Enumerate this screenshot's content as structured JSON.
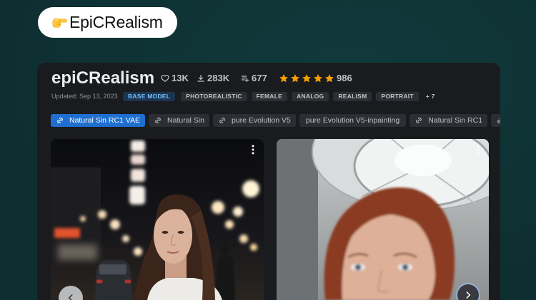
{
  "colors": {
    "background": "#0e2f31",
    "card": "#1a1b1e",
    "accent": "#1f6fd1",
    "star": "#f59f00",
    "base_model_bg": "#1b3450",
    "base_model_text": "#74c0fc",
    "tag_bg": "#2c2e33",
    "text_primary": "#e9ecef",
    "text_secondary": "#c1c2c5",
    "text_muted": "#909296"
  },
  "header": {
    "icon": "pointing-right-hand-icon",
    "title": "EpiCRealism"
  },
  "model": {
    "title": "epiCRealism",
    "stats": [
      {
        "icon": "heart-icon",
        "value": "13K"
      },
      {
        "icon": "download-icon",
        "value": "283K"
      },
      {
        "icon": "playlist-add-icon",
        "value": "677"
      }
    ],
    "rating": {
      "stars": 5,
      "max": 5,
      "count": "986"
    },
    "updated": "Updated: Sep 13, 2023",
    "base_model_label": "BASE MODEL",
    "tags": [
      "PHOTOREALISTIC",
      "FEMALE",
      "ANALOG",
      "REALISM",
      "PORTRAIT"
    ],
    "more_tags": "+ 7"
  },
  "versions": {
    "selected": 0,
    "items": [
      {
        "label": "Natural Sin RC1 VAE",
        "icon": "link-icon"
      },
      {
        "label": "Natural Sin",
        "icon": "link-icon"
      },
      {
        "label": "pure Evolution V5",
        "icon": "link-icon"
      },
      {
        "label": "pure Evolution V5-inpainting"
      },
      {
        "label": "Natural Sin RC1",
        "icon": "link-icon"
      },
      {
        "icon": "link-icon"
      }
    ]
  },
  "gallery": {
    "menu_icon": "dots-vertical-icon",
    "prev_icon": "chevron-left-icon",
    "next_icon": "chevron-right-icon"
  }
}
